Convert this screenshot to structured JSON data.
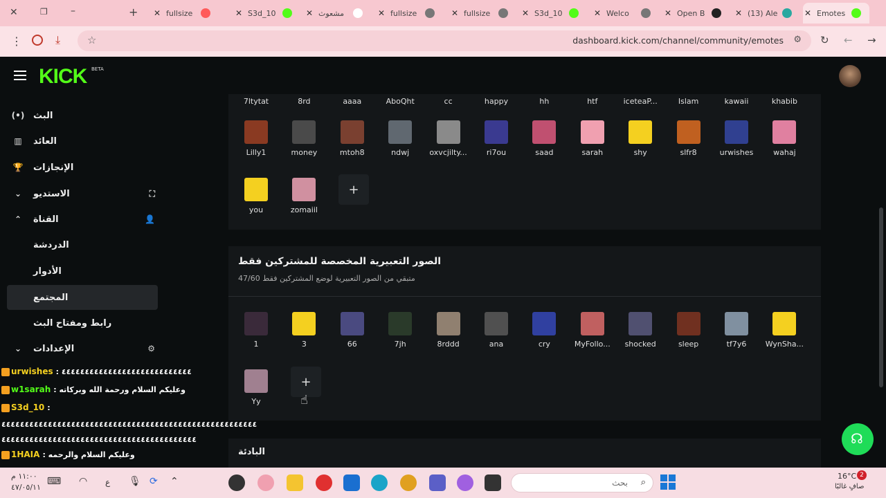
{
  "browser": {
    "tabs": [
      {
        "label": "fullsize",
        "fav": "#ff5a5a"
      },
      {
        "label": "S3d_10",
        "fav": "#53fc18"
      },
      {
        "label": "مشعوث",
        "fav": "#ffffff"
      },
      {
        "label": "fullsize",
        "fav": "#777777"
      },
      {
        "label": "fullsize",
        "fav": "#777777"
      },
      {
        "label": "S3d_10",
        "fav": "#53fc18"
      },
      {
        "label": "Welco",
        "fav": "#777777"
      },
      {
        "label": "Open B",
        "fav": "#222222"
      },
      {
        "label": "(13) Ale",
        "fav": "#2aa8a0"
      },
      {
        "label": "Emotes",
        "fav": "#53fc18"
      }
    ],
    "url": "dashboard.kick.com/channel/community/emotes"
  },
  "header": {
    "logo": "KICK",
    "beta": "BETA"
  },
  "sidebar": {
    "items": [
      {
        "label": "البث",
        "icon": "broadcast-icon"
      },
      {
        "label": "العائد",
        "icon": "chart-icon"
      },
      {
        "label": "الإنجازات",
        "icon": "trophy-icon"
      },
      {
        "label": "الاستديو",
        "icon": "chevron-down-icon"
      },
      {
        "label": "القناة",
        "icon": "chevron-up-icon"
      },
      {
        "label": "الدردشة",
        "icon": ""
      },
      {
        "label": "الأدوار",
        "icon": ""
      },
      {
        "label": "المجتمع",
        "icon": ""
      },
      {
        "label": "رابط ومفتاح البث",
        "icon": ""
      },
      {
        "label": "الإعدادات",
        "icon": "chevron-down-icon"
      }
    ]
  },
  "emotes": {
    "row1_labels": [
      "7ltytat",
      "8rd",
      "aaaa",
      "AboQht",
      "cc",
      "happy",
      "hh",
      "htf",
      "iceteaP...",
      "Islam",
      "kawaii",
      "khabib"
    ],
    "row2": [
      {
        "name": "Lilly1",
        "color": "#8a3a22"
      },
      {
        "name": "money",
        "color": "#4a4a4a"
      },
      {
        "name": "mtoh8",
        "color": "#7a4030"
      },
      {
        "name": "ndwj",
        "color": "#606870"
      },
      {
        "name": "oxvcjilty...",
        "color": "#8a8a8a"
      },
      {
        "name": "ri7ou",
        "color": "#3a3a90"
      },
      {
        "name": "saad",
        "color": "#c05070"
      },
      {
        "name": "sarah",
        "color": "#f0a0b0"
      },
      {
        "name": "shy",
        "color": "#f4d020"
      },
      {
        "name": "slfr8",
        "color": "#c06020"
      },
      {
        "name": "urwishes",
        "color": "#304090"
      },
      {
        "name": "wahaj",
        "color": "#e080a0"
      }
    ],
    "row3": [
      {
        "name": "you",
        "color": "#f4d020"
      },
      {
        "name": "zomaiil",
        "color": "#d090a0"
      }
    ],
    "add_label": "+"
  },
  "subs": {
    "title": "الصور التعبيرية المخصصة للمشتركين فقط",
    "subtitle": "متبقي من الصور التعبيرية لوضع المشتركين فقط 47/60",
    "row1": [
      {
        "name": "1",
        "color": "#3a2a3a"
      },
      {
        "name": "3",
        "color": "#f4d020"
      },
      {
        "name": "66",
        "color": "#4a4a80"
      },
      {
        "name": "7jh",
        "color": "#2a3a2a"
      },
      {
        "name": "8rddd",
        "color": "#908070"
      },
      {
        "name": "ana",
        "color": "#505050"
      },
      {
        "name": "cry",
        "color": "#3040a0"
      },
      {
        "name": "MyFollo...",
        "color": "#c06060"
      },
      {
        "name": "shocked",
        "color": "#505070"
      },
      {
        "name": "sleep",
        "color": "#703020"
      },
      {
        "name": "tf7y6",
        "color": "#8090a0"
      },
      {
        "name": "WynSha...",
        "color": "#f4d020"
      }
    ],
    "row2": [
      {
        "name": "Yy",
        "color": "#a08090"
      }
    ],
    "next_section": "البادئة"
  },
  "chat": {
    "lines": [
      {
        "user": "urwishes",
        "user_color": "#f4d020",
        "text": ": ٤٤٤٤٤٤٤٤٤٤٤٤٤٤٤٤٤٤٤٤٤٤٤٤٤٤٤٤"
      },
      {
        "user": "w1sarah",
        "user_color": "#53fc18",
        "text": ": وعليكم السلام ورحمة الله وبركاته"
      },
      {
        "user": "S3d_10",
        "user_color": "#f4d020",
        "text": ":"
      },
      {
        "user": "",
        "user_color": "#ffffff",
        "text": "٤٤٤٤٤٤٤٤٤٤٤٤٤٤٤٤٤٤٤٤٤٤٤٤٤٤٤٤٤٤٤٤٤٤٤٤٤٤٤٤٤٤٤٤٤٤٤٤٤٤٤٤٤٤٤"
      },
      {
        "user": "",
        "user_color": "#ffffff",
        "text": "٤٤٤٤٤٤٤٤٤٤٤٤٤٤٤٤٤٤٤٤٤٤٤٤٤٤٤٤٤٤٤٤٤٤٤٤٤٤٤٤٤٤"
      },
      {
        "user": "1HAIA",
        "user_color": "#f4d020",
        "text": ": وعليكم السلام والرحمه"
      }
    ]
  },
  "taskbar": {
    "time": "١١:٠٠ م",
    "date": "٤٧/٠٥/١١",
    "lang": "ع",
    "search_placeholder": "بحث",
    "weather_temp": "16°C",
    "weather_text": "صافٍ غالبًا",
    "notif_count": "2"
  }
}
